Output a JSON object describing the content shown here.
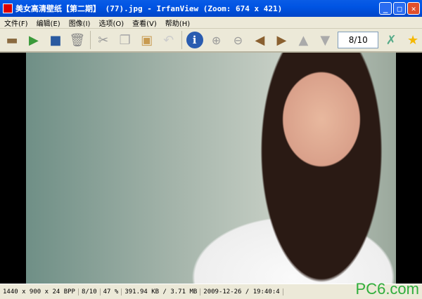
{
  "window": {
    "title": "美女高清壁纸【第二期】 (77).jpg - IrfanView (Zoom: 674 x 421)",
    "minimize": "_",
    "maximize": "□",
    "close": "✕"
  },
  "menu": [
    "文件(F)",
    "编辑(E)",
    "图像(I)",
    "选项(O)",
    "查看(V)",
    "帮助(H)"
  ],
  "toolbar": {
    "counter": "8/10"
  },
  "status": {
    "dimensions": "1440 x 900 x 24 BPP",
    "index": "8/10",
    "zoom": "47 %",
    "size": "391.94 KB / 3.71 MB",
    "datetime": "2009-12-26 / 19:40:4"
  },
  "watermark": "PC6.com"
}
